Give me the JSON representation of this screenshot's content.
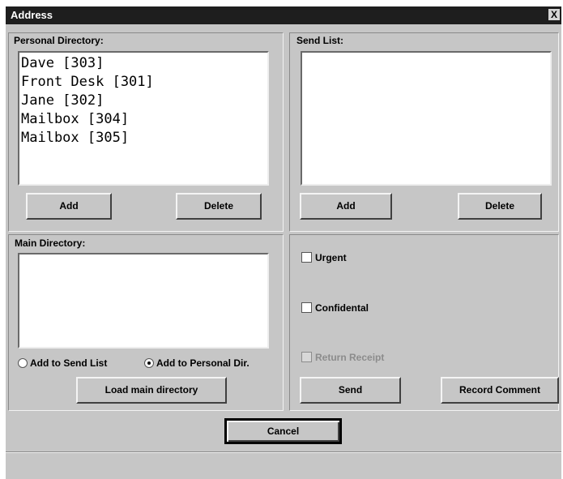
{
  "window": {
    "title": "Address",
    "close_glyph": "X"
  },
  "personal_directory": {
    "label": "Personal Directory:",
    "items": [
      "Dave [303]",
      "Front Desk [301]",
      "Jane [302]",
      "Mailbox [304]",
      "Mailbox [305]"
    ],
    "add_label": "Add",
    "delete_label": "Delete"
  },
  "send_list": {
    "label": "Send List:",
    "items": [],
    "add_label": "Add",
    "delete_label": "Delete"
  },
  "main_directory": {
    "label": "Main Directory:",
    "items": [],
    "radio_send_list": "Add to Send List",
    "radio_personal": "Add to Personal Dir.",
    "selected": "personal",
    "load_label": "Load main directory"
  },
  "options": {
    "urgent_label": "Urgent",
    "confidential_label": "Confidental",
    "return_receipt_label": "Return Receipt",
    "send_label": "Send",
    "record_comment_label": "Record Comment"
  },
  "footer": {
    "cancel_label": "Cancel"
  }
}
